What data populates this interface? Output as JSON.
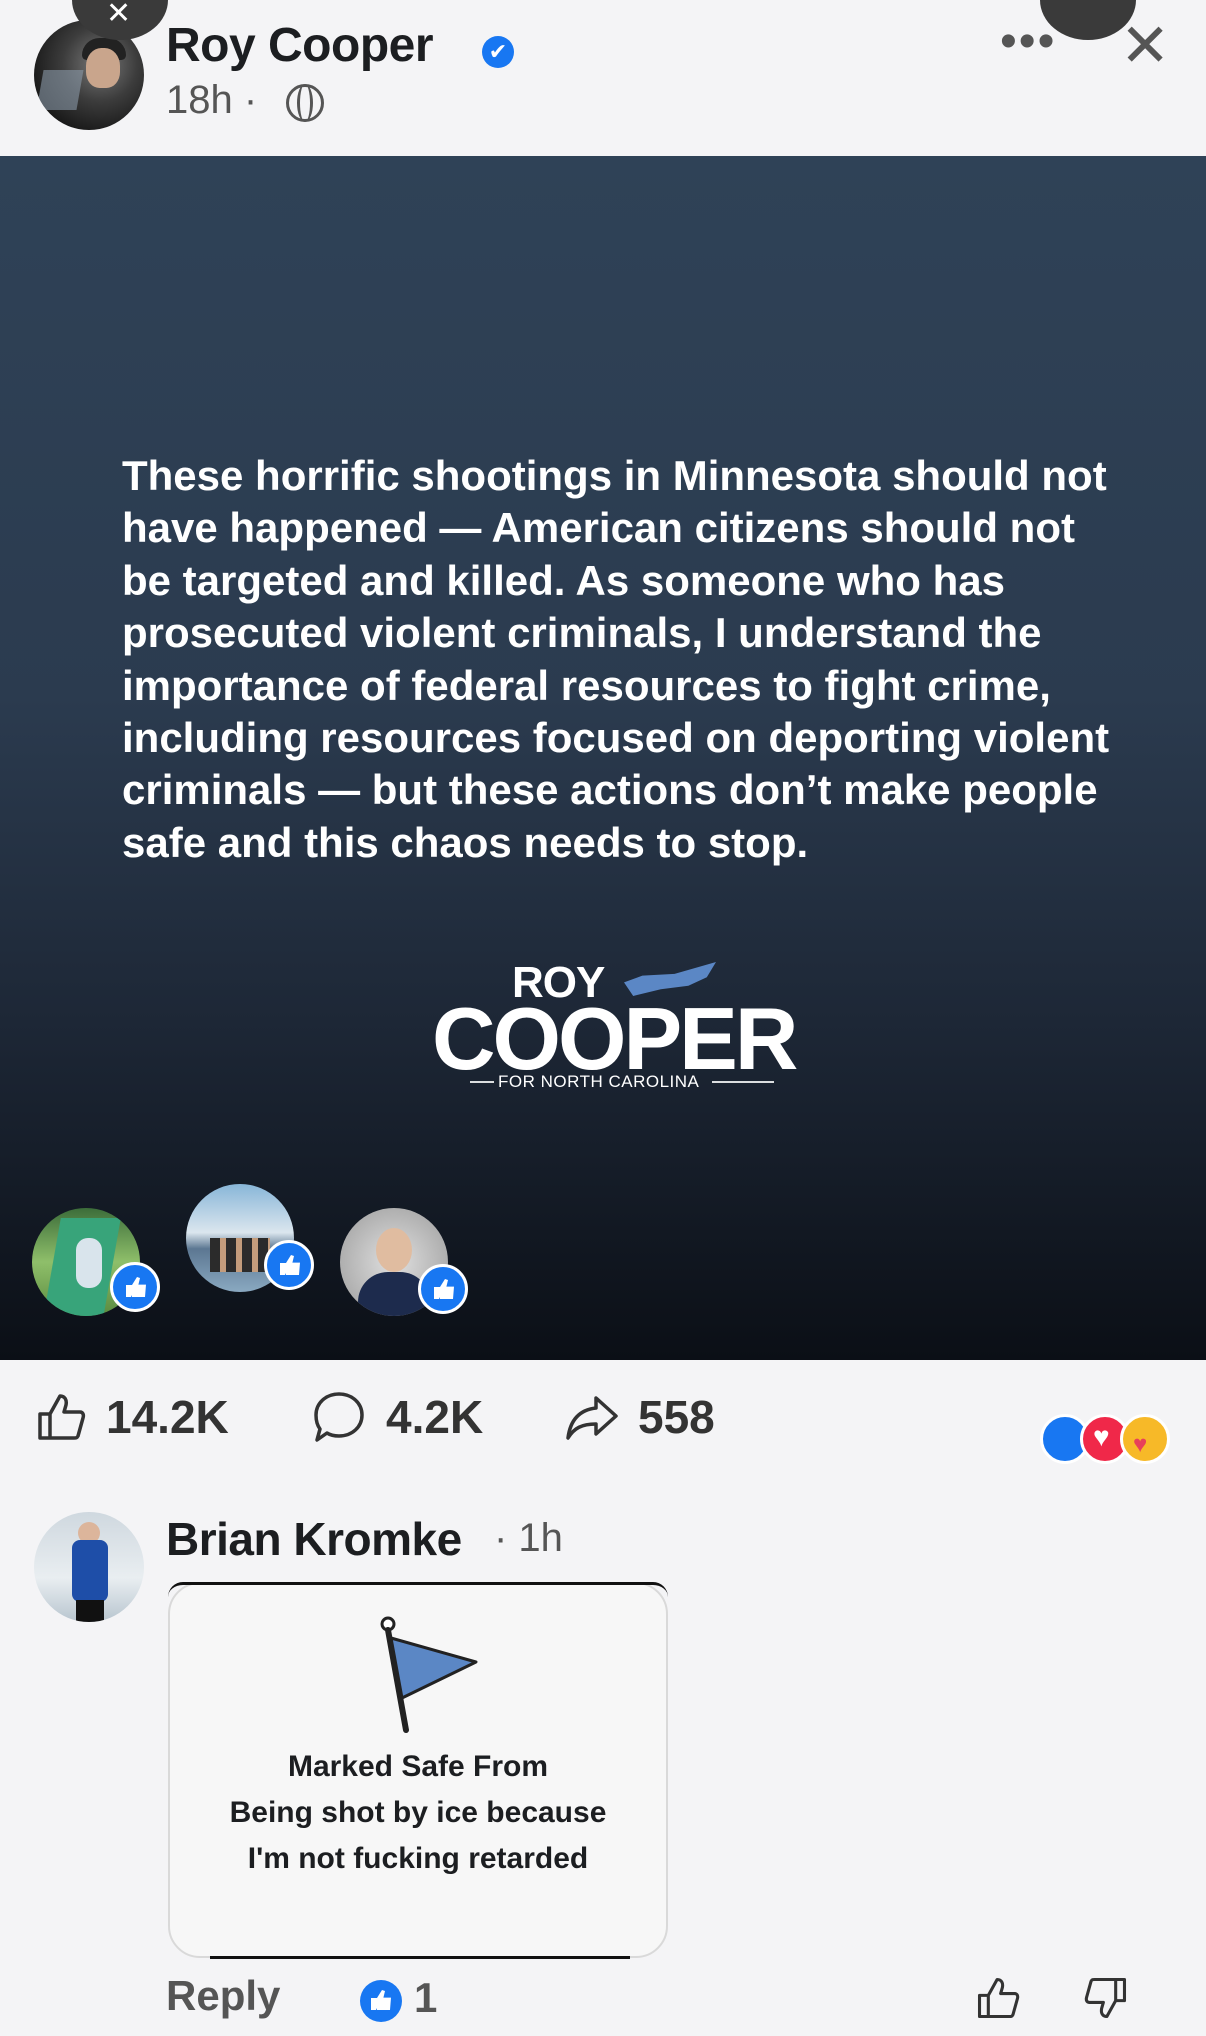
{
  "post": {
    "author": "Roy Cooper",
    "verified_mark": "✔",
    "time": "18h ·",
    "quote": "These horrific shootings in Minnesota should not have happened — American citizens should not be targeted and killed. As someone who has prosecuted violent criminals, I understand the importance of federal resources to fight crime, including resources focused on deporting violent criminals — but these actions don’t make people safe and this chaos needs to stop.",
    "logo": {
      "line1": "ROY",
      "line2": "COOPER",
      "tagline": "FOR NORTH CAROLINA"
    },
    "icons": {
      "more": "more-options-icon",
      "close": "close-icon",
      "audience": "globe-icon"
    }
  },
  "stats": {
    "likes": "14.2K",
    "comments": "4.2K",
    "shares": "558",
    "reactions": [
      "like",
      "love",
      "care"
    ]
  },
  "comment": {
    "author": "Brian Kromke",
    "time": "· 1h",
    "card_lines": [
      "Marked Safe From",
      "Being shot by ice because",
      "I'm not fucking retarded"
    ],
    "reply_label": "Reply",
    "like_count": "1"
  },
  "colors": {
    "facebook_blue": "#1877f2",
    "post_bg_top": "#2f4257",
    "post_bg_bottom": "#0b0f16",
    "flag_blue": "#5b87c5"
  }
}
